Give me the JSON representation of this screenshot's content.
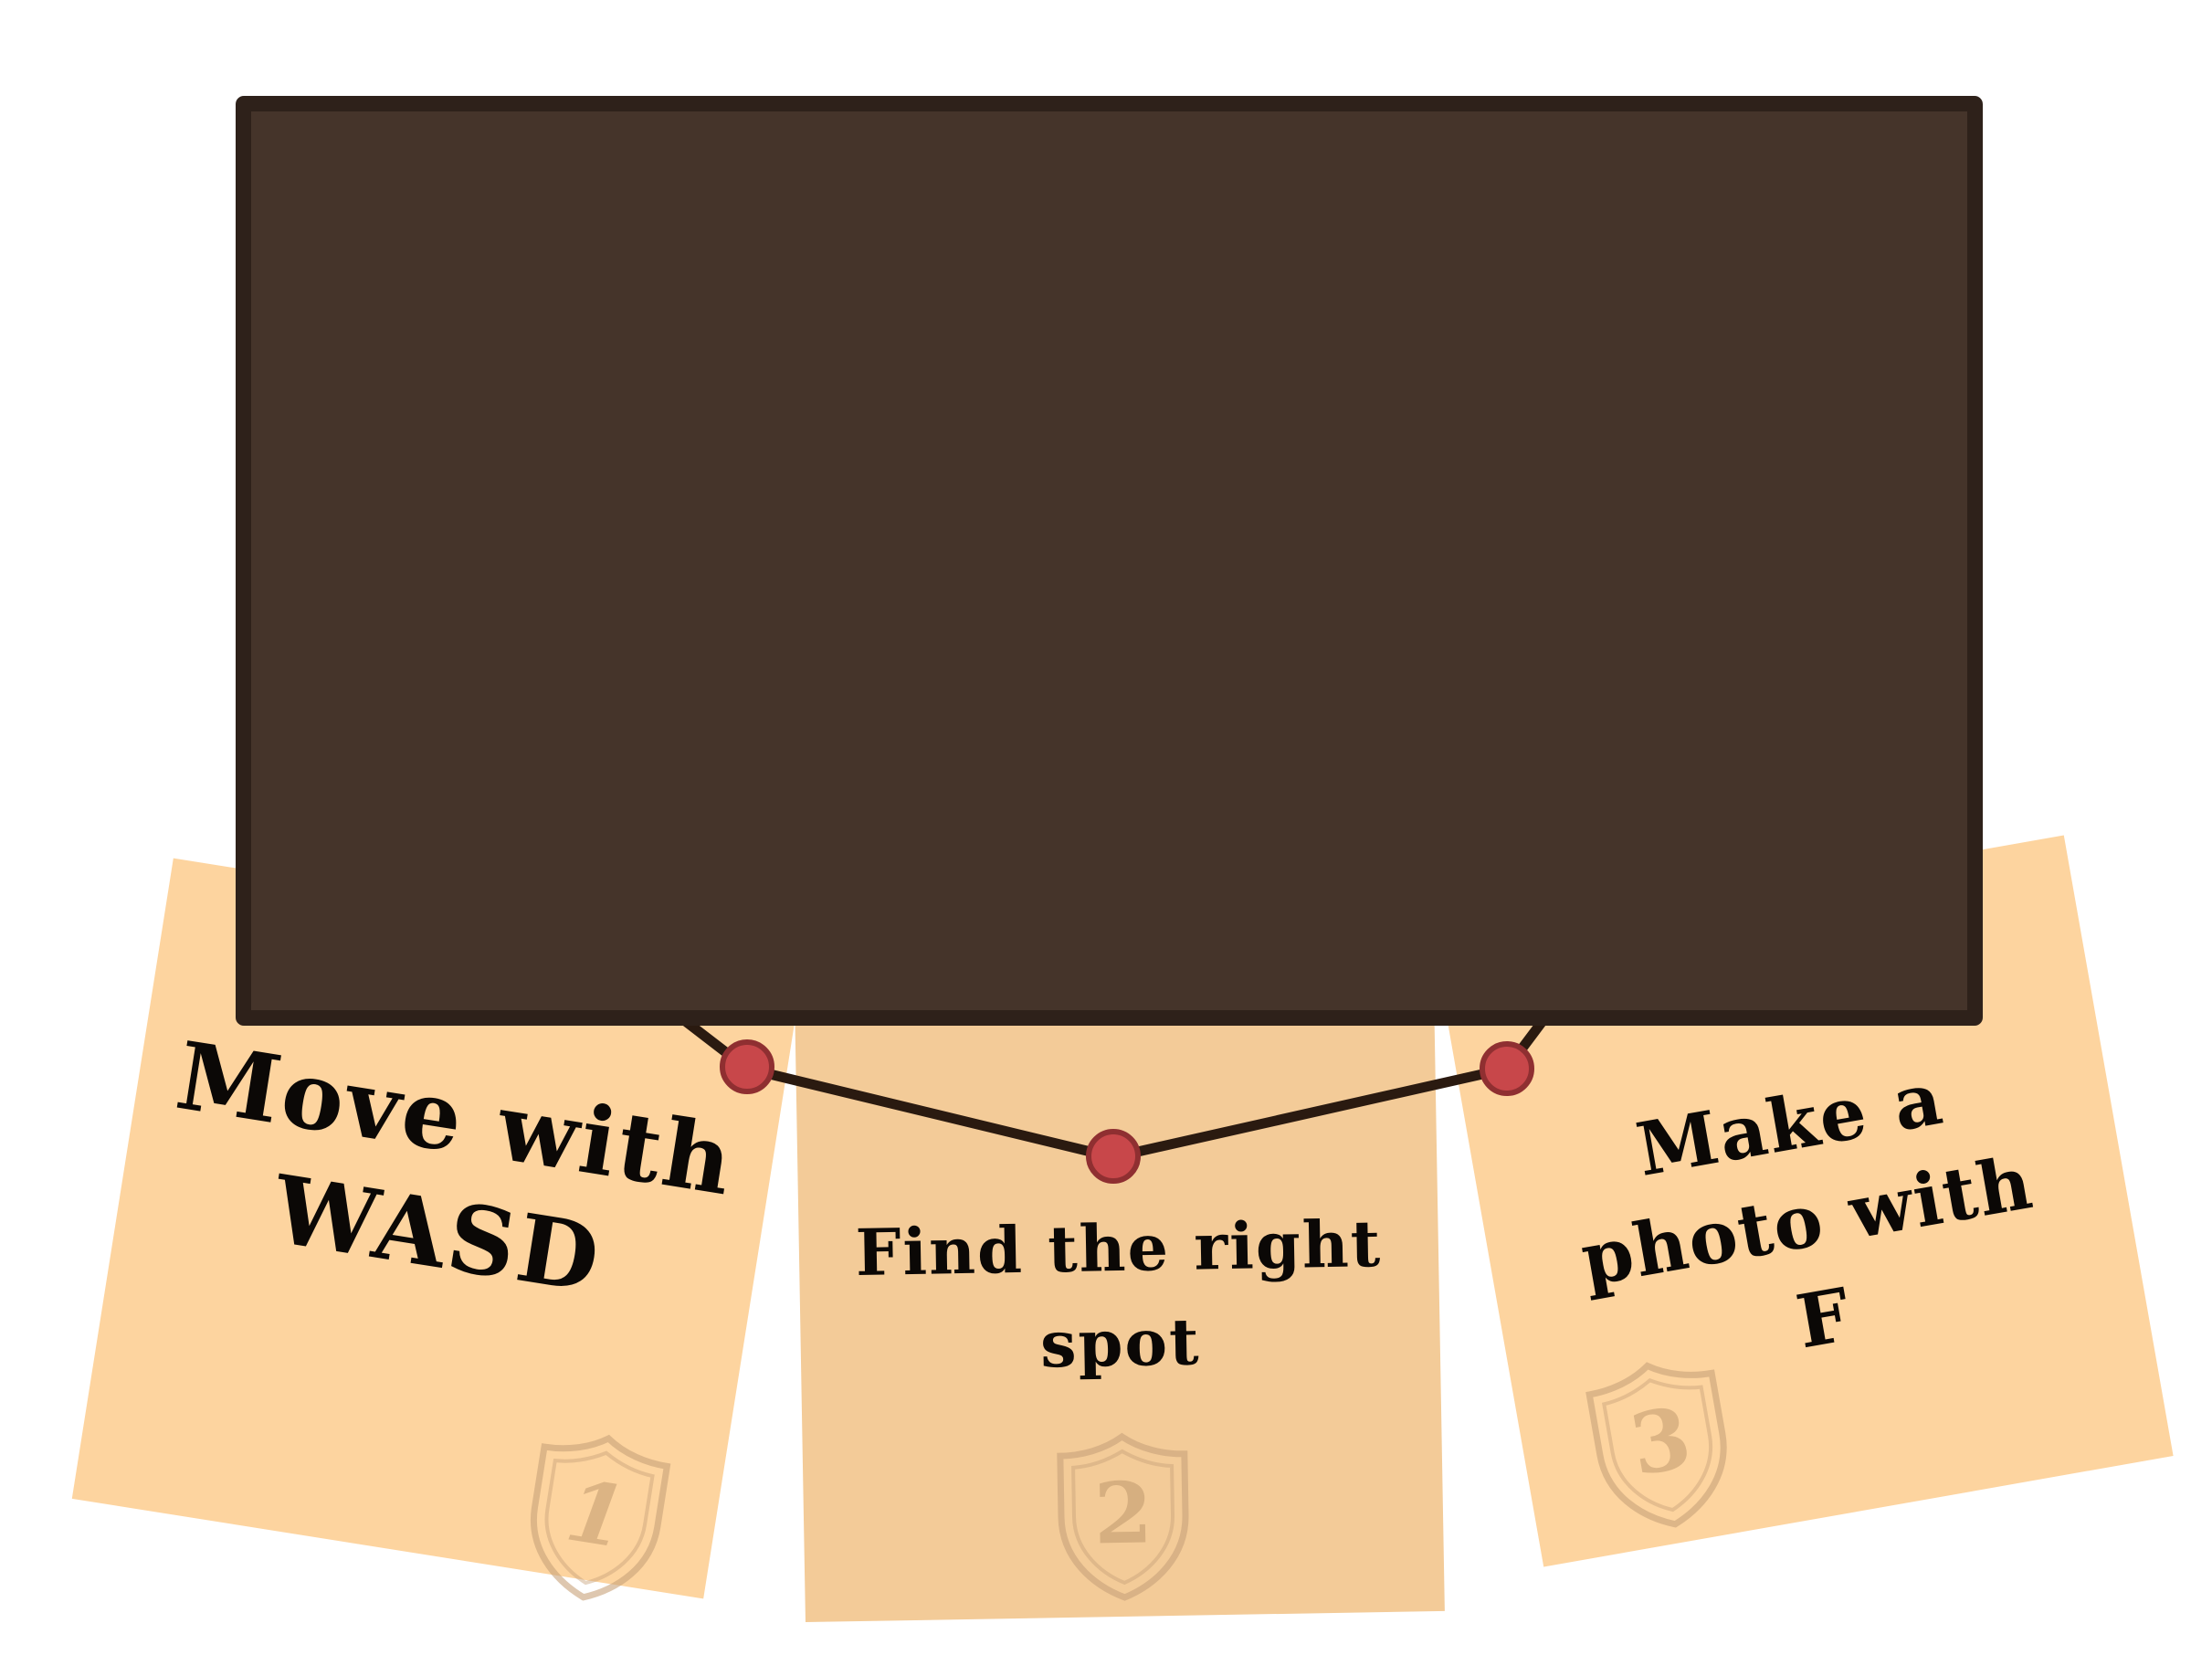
{
  "notes": [
    {
      "lines": [
        "Move with",
        "WASD"
      ],
      "badge": "1"
    },
    {
      "lines": [
        "Find the right",
        "spot"
      ],
      "badge": "2"
    },
    {
      "lines": [
        "Make a",
        "photo with",
        "F"
      ],
      "badge": "3"
    }
  ],
  "colors": {
    "note_left": "#fdd49f",
    "note_middle": "#f3cb98",
    "note_right": "#fdd49f",
    "board_fill": "#45342a",
    "board_border": "#2e211a",
    "string": "#2a1a10",
    "pin": "#c8474a",
    "badge": "#c8a27a"
  },
  "icons": {
    "badge": "shield-icon",
    "pin": "pushpin-icon"
  }
}
